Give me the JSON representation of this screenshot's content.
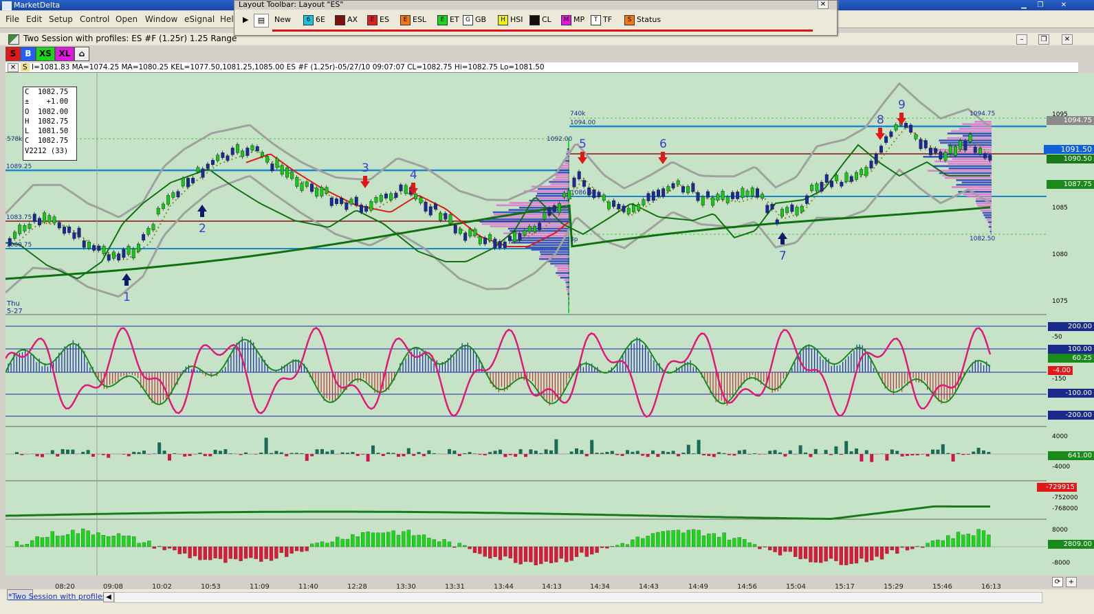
{
  "app": {
    "title": "MarketDelta"
  },
  "menu": {
    "items": [
      "File",
      "Edit",
      "Setup",
      "Control",
      "Open",
      "Window",
      "eSignal",
      "Help"
    ]
  },
  "layout_toolbar": {
    "title": "Layout Toolbar: Layout \"ES\"",
    "new_label": "New",
    "buttons": [
      {
        "key": "6",
        "label": "6E",
        "color": "#19c3e0"
      },
      {
        "key": "",
        "label": "AX",
        "color": "#7a1010"
      },
      {
        "key": "E",
        "label": "ES",
        "color": "#e02020"
      },
      {
        "key": "E",
        "label": "ESL",
        "color": "#f07818"
      },
      {
        "key": "E",
        "label": "ET",
        "color": "#18d818"
      },
      {
        "key": "G",
        "label": "GB",
        "color": "#ffffff"
      },
      {
        "key": "H",
        "label": "HSI",
        "color": "#f0f018"
      },
      {
        "key": "",
        "label": "CL",
        "color": "#101010"
      },
      {
        "key": "M",
        "label": "MP",
        "color": "#e018e0"
      },
      {
        "key": "T",
        "label": "TF",
        "color": "#ffffff"
      },
      {
        "key": "S",
        "label": "Status",
        "color": "#f07818"
      }
    ]
  },
  "chart_window": {
    "title": "Two Session with profiles: ES #F (1.25r) 1.25 Range",
    "size_buttons": [
      "S",
      "B",
      "XS",
      "XL"
    ],
    "info_line": "I=1081.83  MA=1074.25  MA=1080.25  KEL=1077.50,1081.25,1085.00  ES #F (1.25r)-05/27/10 09:07:07 CL=1082.75 Hi=1082.75 Lo=1081.50",
    "ohlc_box": [
      {
        "k": "C",
        "v": "1082.75"
      },
      {
        "k": "±",
        "v": "+1.00"
      },
      {
        "k": "O",
        "v": "1082.00"
      },
      {
        "k": "H",
        "v": "1082.75"
      },
      {
        "k": "L",
        "v": "1081.50"
      },
      {
        "k": "C",
        "v": "1082.75"
      },
      {
        "k": "V",
        "v": "2212 (33)"
      }
    ],
    "day_label": [
      "Thu",
      "5-27"
    ],
    "left_labels": [
      "578k",
      "1089.25",
      "1083.75",
      "1080.75"
    ],
    "profile_labels": [
      "1092.00",
      "740k",
      "1094.00",
      "1086.50",
      "3p",
      "1094.75",
      "1082.50"
    ],
    "annotations": [
      "1",
      "2",
      "3",
      "4",
      "5",
      "6",
      "7",
      "8",
      "9"
    ],
    "time_labels": [
      "08:20",
      "09:08",
      "10:02",
      "10:53",
      "11:09",
      "11:40",
      "12:28",
      "13:30",
      "13:31",
      "13:44",
      "14:13",
      "14:34",
      "14:43",
      "14:49",
      "14:56",
      "15:04",
      "15:17",
      "15:29",
      "15:46",
      "16:13"
    ],
    "price_axis": [
      "1095",
      "1090",
      "1085",
      "1080",
      "1075"
    ],
    "price_tags": [
      {
        "text": "1094.75",
        "bg": "#8a8a8a",
        "fg": "#fff"
      },
      {
        "text": "1091.50",
        "bg": "#1060d8",
        "fg": "#fff"
      },
      {
        "text": "1090.50",
        "bg": "#1a7a1a",
        "fg": "#fff"
      },
      {
        "text": "1087.75",
        "bg": "#1a8a1a",
        "fg": "#fff"
      }
    ],
    "osc_axis": [
      "200.00",
      "100.00",
      "60.25",
      "-4.00",
      "-50",
      "-100.00",
      "-150",
      "-200.00"
    ],
    "vol_axis": [
      "4000",
      "641.00",
      "-4000"
    ],
    "cum_axis": [
      "-729915",
      "-752000",
      "-768000"
    ],
    "delta_axis": [
      "8000",
      "2809.00",
      "-8000"
    ],
    "tab_label": "*Two Session with profiles"
  }
}
